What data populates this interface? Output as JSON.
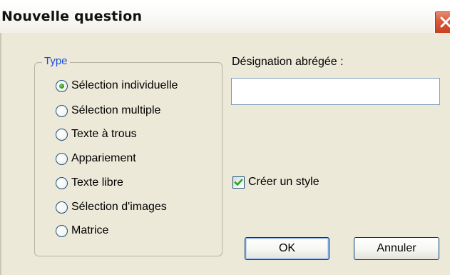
{
  "window": {
    "title": "Nouvelle question"
  },
  "type_group": {
    "legend": "Type",
    "options": [
      {
        "label": "Sélection individuelle",
        "checked": true
      },
      {
        "label": "Sélection multiple",
        "checked": false
      },
      {
        "label": "Texte à trous",
        "checked": false
      },
      {
        "label": "Appariement",
        "checked": false
      },
      {
        "label": "Texte libre",
        "checked": false
      },
      {
        "label": "Sélection d'images",
        "checked": false
      },
      {
        "label": "Matrice",
        "checked": false
      }
    ]
  },
  "short_name": {
    "label": "Désignation abrégée :",
    "value": ""
  },
  "create_style": {
    "label": "Créer un style",
    "checked": true
  },
  "buttons": {
    "ok": "OK",
    "cancel": "Annuler"
  },
  "icons": {
    "close": "close-icon",
    "check": "checkmark-icon"
  }
}
